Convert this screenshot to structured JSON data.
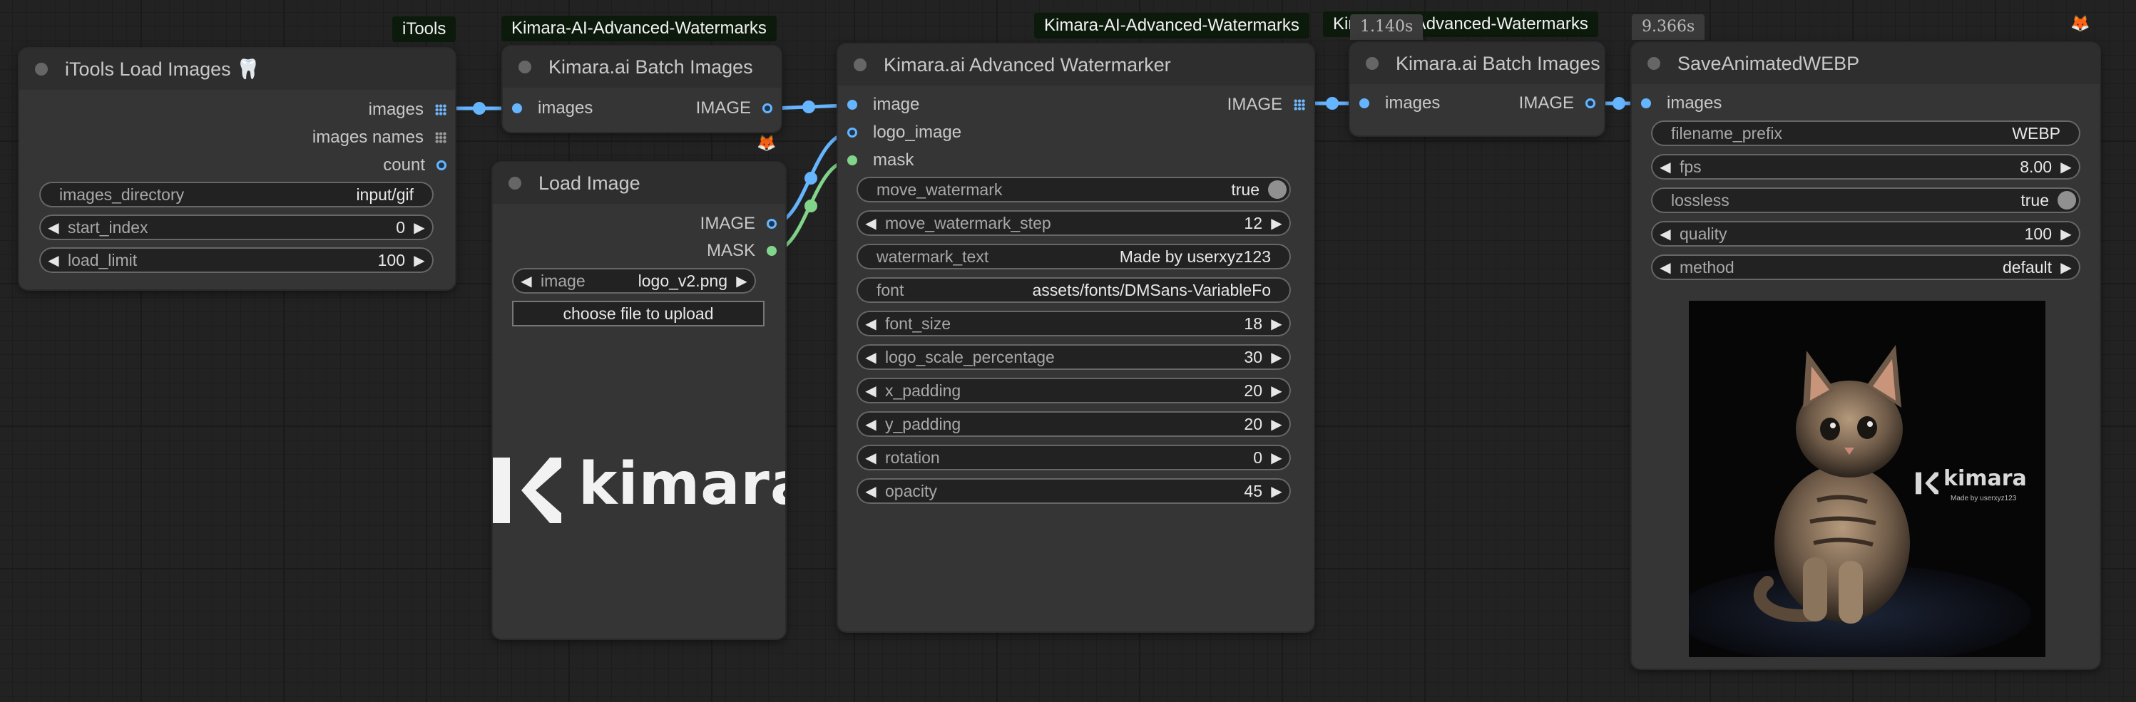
{
  "badges": {
    "itools": "iTools",
    "batch1_group": "Kimara-AI-Advanced-Watermarks",
    "watermarker_group": "Kimara-AI-Advanced-Watermarks",
    "batch2_group": "Kimara-AI-Advanced-Watermarks",
    "batch2_timing": "1.140s",
    "save_timing": "9.366s"
  },
  "nodes": {
    "load_images": {
      "title": "iTools Load Images 🦷",
      "outputs": [
        "images",
        "images names",
        "count"
      ],
      "widgets": [
        {
          "label": "images_directory",
          "value": "input/gif"
        },
        {
          "label": "start_index",
          "value": "0"
        },
        {
          "label": "load_limit",
          "value": "100"
        }
      ]
    },
    "batch1": {
      "title": "Kimara.ai Batch Images",
      "input": "images",
      "output": "IMAGE"
    },
    "load_image": {
      "title": "Load Image",
      "outputs": [
        "IMAGE",
        "MASK"
      ],
      "image_label": "image",
      "image_value": "logo_v2.png",
      "upload_label": "choose file to upload",
      "preview_text": "kimara"
    },
    "watermarker": {
      "title": "Kimara.ai Advanced Watermarker",
      "inputs": [
        "image",
        "logo_image",
        "mask"
      ],
      "output": "IMAGE",
      "widgets": [
        {
          "label": "move_watermark",
          "value": "true"
        },
        {
          "label": "move_watermark_step",
          "value": "12"
        },
        {
          "label": "watermark_text",
          "value": "Made by userxyz123"
        },
        {
          "label": "font",
          "value": "assets/fonts/DMSans-VariableFo"
        },
        {
          "label": "font_size",
          "value": "18"
        },
        {
          "label": "logo_scale_percentage",
          "value": "30"
        },
        {
          "label": "x_padding",
          "value": "20"
        },
        {
          "label": "y_padding",
          "value": "20"
        },
        {
          "label": "rotation",
          "value": "0"
        },
        {
          "label": "opacity",
          "value": "45"
        }
      ]
    },
    "batch2": {
      "title": "Kimara.ai Batch Images",
      "input": "images",
      "output": "IMAGE"
    },
    "save_webp": {
      "title": "SaveAnimatedWEBP",
      "input": "images",
      "widgets": [
        {
          "label": "filename_prefix",
          "value": "WEBP"
        },
        {
          "label": "fps",
          "value": "8.00"
        },
        {
          "label": "lossless",
          "value": "true"
        },
        {
          "label": "quality",
          "value": "100"
        },
        {
          "label": "method",
          "value": "default"
        }
      ],
      "preview_watermark": "kimara",
      "preview_watermark_sub": "Made by userxyz123"
    }
  },
  "colors": {
    "image_link": "#66b5ff",
    "mask_link": "#82d48a",
    "badge_bg": "#0c1a0c",
    "node_bg": "#353535",
    "canvas_bg": "#222222"
  }
}
